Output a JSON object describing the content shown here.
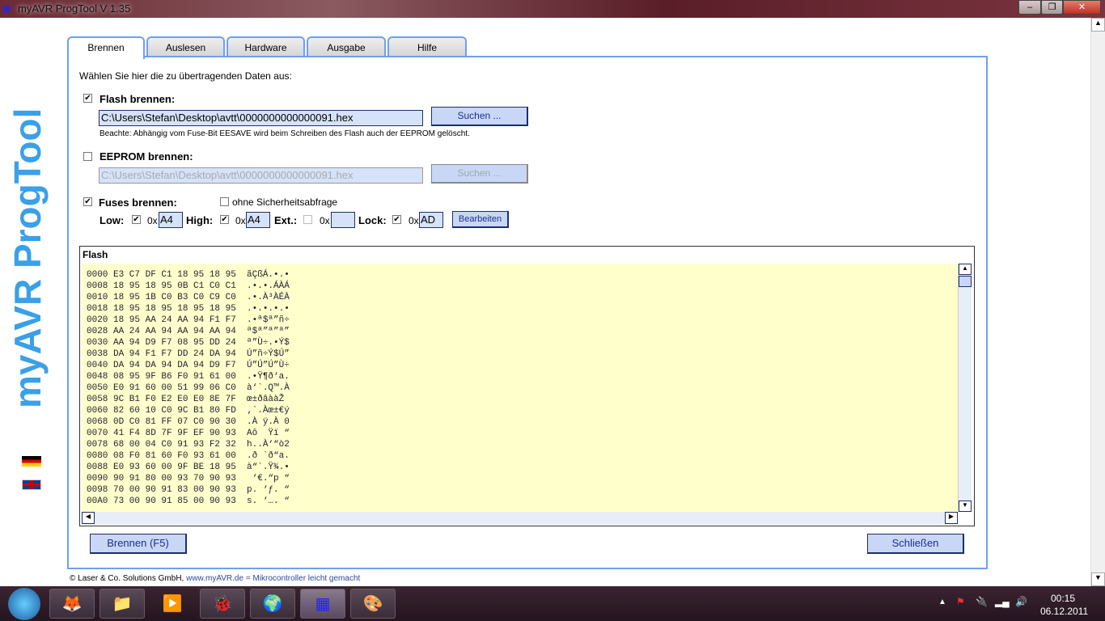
{
  "window": {
    "title": "myAVR ProgTool V 1.35",
    "min": "–",
    "max": "❐",
    "close": "✕"
  },
  "logo_text": "myAVR ProgTool",
  "tabs": [
    "Brennen",
    "Auslesen",
    "Hardware",
    "Ausgabe",
    "Hilfe"
  ],
  "prompt": "Wählen Sie hier die zu übertragenden Daten aus:",
  "flash": {
    "checked": true,
    "label": "Flash brennen:",
    "path": "C:\\Users\\Stefan\\Desktop\\avtt\\0000000000000091.hex",
    "search": "Suchen ...",
    "note": "Beachte: Abhängig vom Fuse-Bit EESAVE wird beim Schreiben des Flash auch der EEPROM gelöscht."
  },
  "eeprom": {
    "checked": false,
    "label": "EEPROM brennen:",
    "path": "C:\\Users\\Stefan\\Desktop\\avtt\\0000000000000091.hex",
    "search": "Suchen ..."
  },
  "fuses": {
    "checked": true,
    "label": "Fuses brennen:",
    "no_confirm_label": "ohne Sicherheitsabfrage",
    "prefix": "0x",
    "low": {
      "label": "Low:",
      "value": "A4"
    },
    "high": {
      "label": "High:",
      "value": "A4"
    },
    "ext": {
      "label": "Ext.:",
      "value": ""
    },
    "lock": {
      "label": "Lock:",
      "value": "AD"
    },
    "edit": "Bearbeiten"
  },
  "flash_view": {
    "title": "Flash",
    "rows": [
      "0000 E3 C7 DF C1 18 95 18 95  ãÇßÁ.•.•",
      "0008 18 95 18 95 0B C1 C0 C1  .•.•.ÁÀÁ",
      "0010 18 95 1B C0 B3 C0 C9 C0  .•.À³ÀÉÀ",
      "0018 18 95 18 95 18 95 18 95  .•.•.•.•",
      "0020 18 95 AA 24 AA 94 F1 F7  .•ª$ª”ñ÷",
      "0028 AA 24 AA 94 AA 94 AA 94  ª$ª”ª”ª”",
      "0030 AA 94 D9 F7 08 95 DD 24  ª”Ù÷.•Ý$",
      "0038 DA 94 F1 F7 DD 24 DA 94  Ú”ñ÷Ý$Ú”",
      "0040 DA 94 DA 94 DA 94 D9 F7  Ú”Ú”Ú”Ù÷",
      "0048 08 95 9F B6 F0 91 61 00  .•Ÿ¶ð‘a.",
      "0050 E0 91 60 00 51 99 06 C0  à‘`.Q™.À",
      "0058 9C B1 F0 E2 E0 E0 8E 7F  œ±ðâààŽ",
      "0060 82 60 10 C0 9C B1 80 FD  ‚`.Àœ±€ý",
      "0068 0D C0 81 FF 07 C0 90 30  .À ÿ.À 0",
      "0070 41 F4 8D 7F 9F EF 90 93  Aô  Ÿï “",
      "0078 68 00 04 C0 91 93 F2 32  h..À‘“ò2",
      "0080 08 F0 81 60 F0 93 61 00  .ð `ð“a.",
      "0088 E0 93 60 00 9F BE 18 95  à“`.Ÿ¾.•",
      "0090 90 91 80 00 93 70 90 93   ‘€.“p “",
      "0098 70 00 90 91 83 00 90 93  p. ‘ƒ. “",
      "00A0 73 00 90 91 85 00 90 93  s. ‘…. “"
    ]
  },
  "buttons": {
    "burn": "Brennen (F5)",
    "close": "Schließen"
  },
  "footer": {
    "company": "© Laser & Co. Solutions GmbH,",
    "link": "www.myAVR.de",
    "slogan": "=  Mikrocontroller leicht gemacht"
  },
  "taskbar": {
    "apps": [
      "firefox-icon",
      "explorer-icon",
      "media-player-icon",
      "bug-icon",
      "globe-icon",
      "network-icon",
      "paint-icon"
    ],
    "time": "00:15",
    "date": "06.12.2011"
  }
}
